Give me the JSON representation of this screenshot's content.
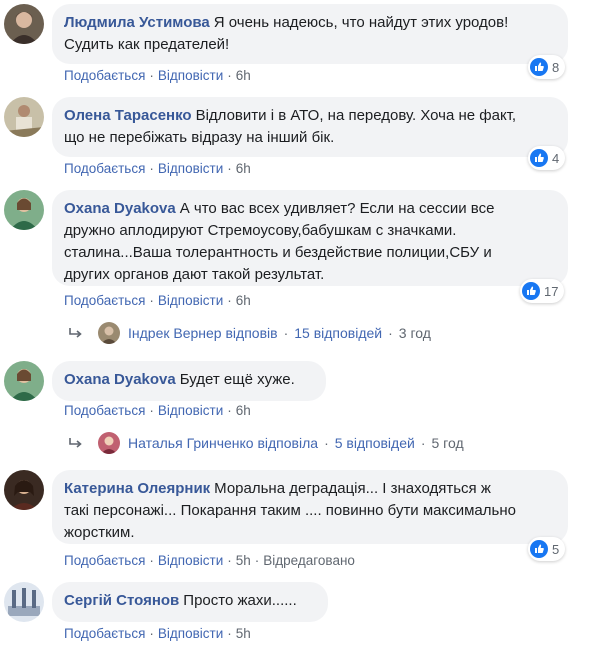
{
  "labels": {
    "like": "Подобається",
    "reply": "Відповісти",
    "dot": "·",
    "edited": "Відредаговано"
  },
  "comments": [
    {
      "author": "Людмила Устимова",
      "text_lines": [
        "Я очень надеюсь, что найдут этих уродов!",
        "Судить как предателей!"
      ],
      "time": "6h",
      "reactions": "8"
    },
    {
      "author": "Олена Тарасенко",
      "text_lines": [
        "Відловити і в АТО, на передову. Хоча не факт,",
        "що не перебіжать відразу на інший бік."
      ],
      "time": "6h",
      "reactions": "4"
    },
    {
      "author": "Oxana Dyakova",
      "text_lines": [
        "А что вас всех удивляет? Если на сессии все",
        "дружно аплодируют Стремоусову,бабушкам с значками.",
        "сталина...Ваша толерантность и бездействие полиции,СБУ и",
        "других органов дают такой результат."
      ],
      "time": "6h",
      "reactions": "17"
    },
    {
      "author": "Oxana Dyakova",
      "text_lines": [
        "Будет ещё хуже."
      ],
      "time": "6h"
    },
    {
      "author": "Катерина Олеярник",
      "text_lines": [
        "Моральна деградація... І знаходяться ж",
        "такі персонажі... Покарання таким .... повинно бути максимально",
        "жорстким."
      ],
      "time": "5h",
      "reactions": "5"
    },
    {
      "author": "Сергій Стоянов",
      "text_lines": [
        "Просто жахи......"
      ],
      "time": "5h"
    }
  ],
  "replies": [
    {
      "name": "Індрек Вернер відповів",
      "count": "15 відповідей",
      "time": "3 год"
    },
    {
      "name": "Наталья Гринченко відповіла",
      "count": "5 відповідей",
      "time": "5 год"
    }
  ],
  "colors": {
    "link": "#4267b2",
    "author": "#385898",
    "bubble": "#f2f3f5",
    "like_badge": "#1877f2"
  }
}
